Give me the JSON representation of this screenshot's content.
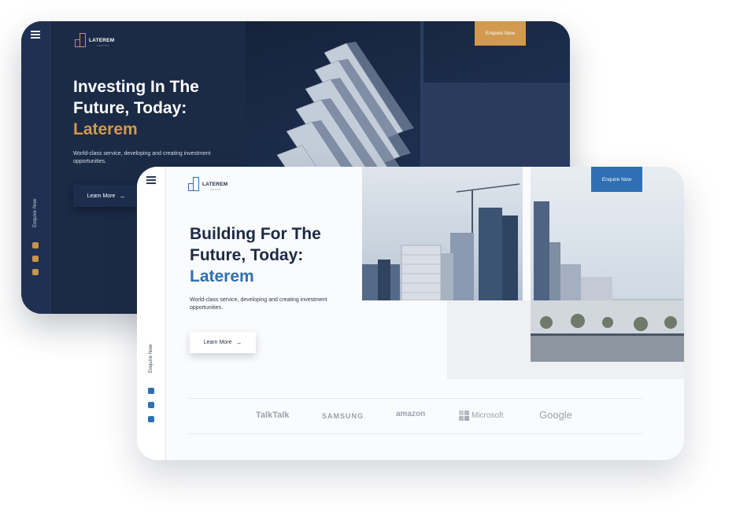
{
  "dark_card": {
    "brand_name": "LATEREM",
    "brand_sub": "CAPITAL",
    "enquire_label": "Enquire Now",
    "headline_line1": "Investing In The",
    "headline_line2": "Future, Today:",
    "headline_accent": "Laterem",
    "subtext": "World-class service, developing and creating investment opportunities.",
    "learn_more_label": "Learn More",
    "arrow": "→",
    "sidebar_vertical_label": "Enquire Now",
    "accent_color": "#d19a4e"
  },
  "light_card": {
    "brand_name": "LATEREM",
    "brand_sub": "GROUP",
    "enquire_label": "Enquire Now",
    "headline_line1": "Building For The",
    "headline_line2": "Future, Today:",
    "headline_accent": "Laterem",
    "subtext": "World-class service, developing and creating investment opportunities.",
    "learn_more_label": "Learn More",
    "arrow": "→",
    "sidebar_vertical_label": "Enquire Now",
    "accent_color": "#2f6fb4",
    "partner_logos": {
      "talktalk": "TalkTalk",
      "samsung": "SAMSUNG",
      "amazon": "amazon",
      "microsoft": "Microsoft",
      "google": "Google"
    }
  },
  "social_icons": [
    "instagram-icon",
    "facebook-icon",
    "linkedin-icon"
  ]
}
